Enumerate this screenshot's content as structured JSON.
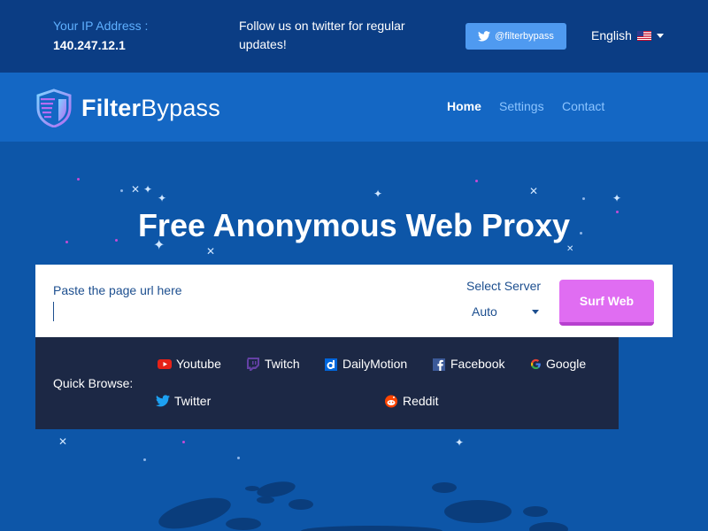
{
  "topbar": {
    "ip_label": "Your IP Address :",
    "ip_value": "140.247.12.1",
    "follow_text": "Follow us on twitter for regular updates!",
    "twitter_handle": "@filterbypass",
    "language": "English",
    "language_flag_icon": "us-flag-icon"
  },
  "nav": {
    "logo_part1": "Filter",
    "logo_part2": "Bypass",
    "links": [
      "Home",
      "Settings",
      "Contact"
    ]
  },
  "hero": {
    "title": "Free Anonymous Web Proxy"
  },
  "url_form": {
    "label": "Paste the page url here",
    "input_value": "",
    "input_placeholder": "",
    "server_label": "Select Server",
    "server_value": "Auto",
    "submit_label": "Surf Web"
  },
  "quick_browse": {
    "label": "Quick Browse:",
    "sites": [
      {
        "label": "Youtube",
        "icon": "youtube-icon"
      },
      {
        "label": "Twitch",
        "icon": "twitch-icon"
      },
      {
        "label": "DailyMotion",
        "icon": "dailymotion-icon"
      },
      {
        "label": "Facebook",
        "icon": "facebook-icon"
      },
      {
        "label": "Google",
        "icon": "google-icon"
      },
      {
        "label": "Twitter",
        "icon": "twitter-icon"
      },
      {
        "label": "Reddit",
        "icon": "reddit-icon"
      }
    ]
  },
  "colors": {
    "topbar_bg": "#0b3d84",
    "navbar_bg": "#1467c4",
    "hero_bg": "#0d56a8",
    "accent_button": "#e06df2",
    "twitter_button": "#4f9af0",
    "quick_browse_bg": "#1c2845"
  }
}
